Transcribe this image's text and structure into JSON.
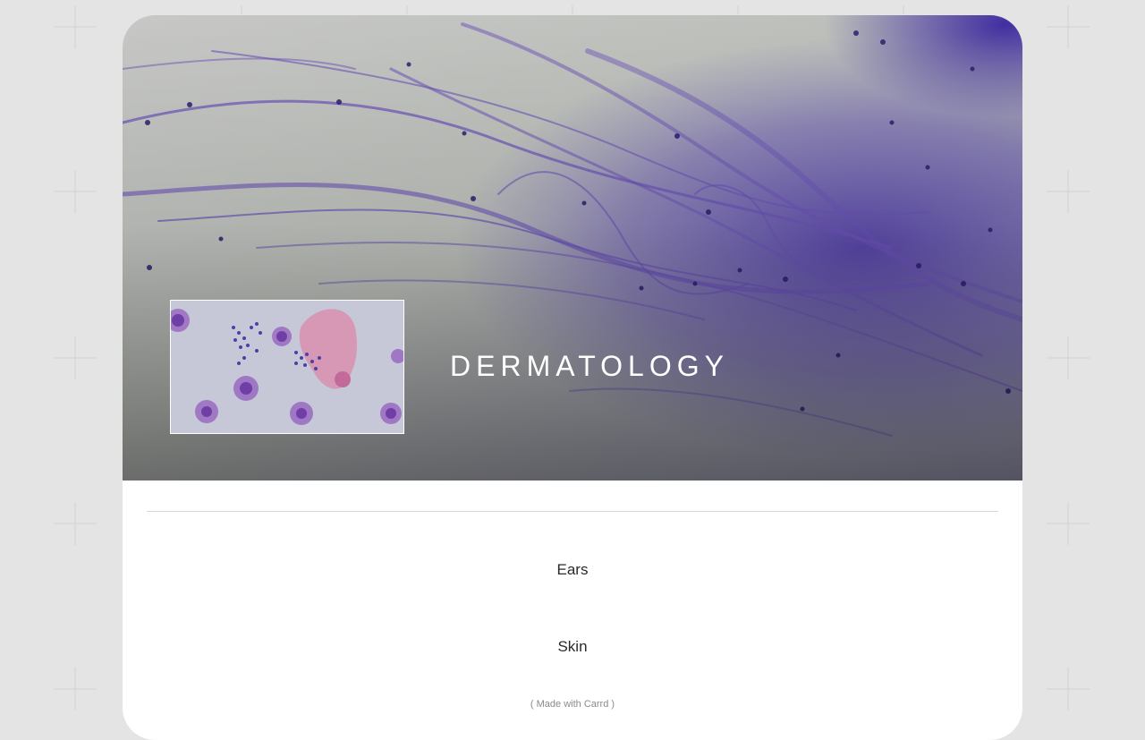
{
  "hero": {
    "title": "DERMATOLOGY"
  },
  "nav": {
    "links": [
      {
        "label": "Ears"
      },
      {
        "label": "Skin"
      }
    ]
  },
  "footer": {
    "credit": "( Made with Carrd )"
  },
  "colors": {
    "page_background": "#e4e4e4",
    "card_background": "#ffffff",
    "stain_purple": "#5a3fb0",
    "title_text": "#ffffff"
  }
}
